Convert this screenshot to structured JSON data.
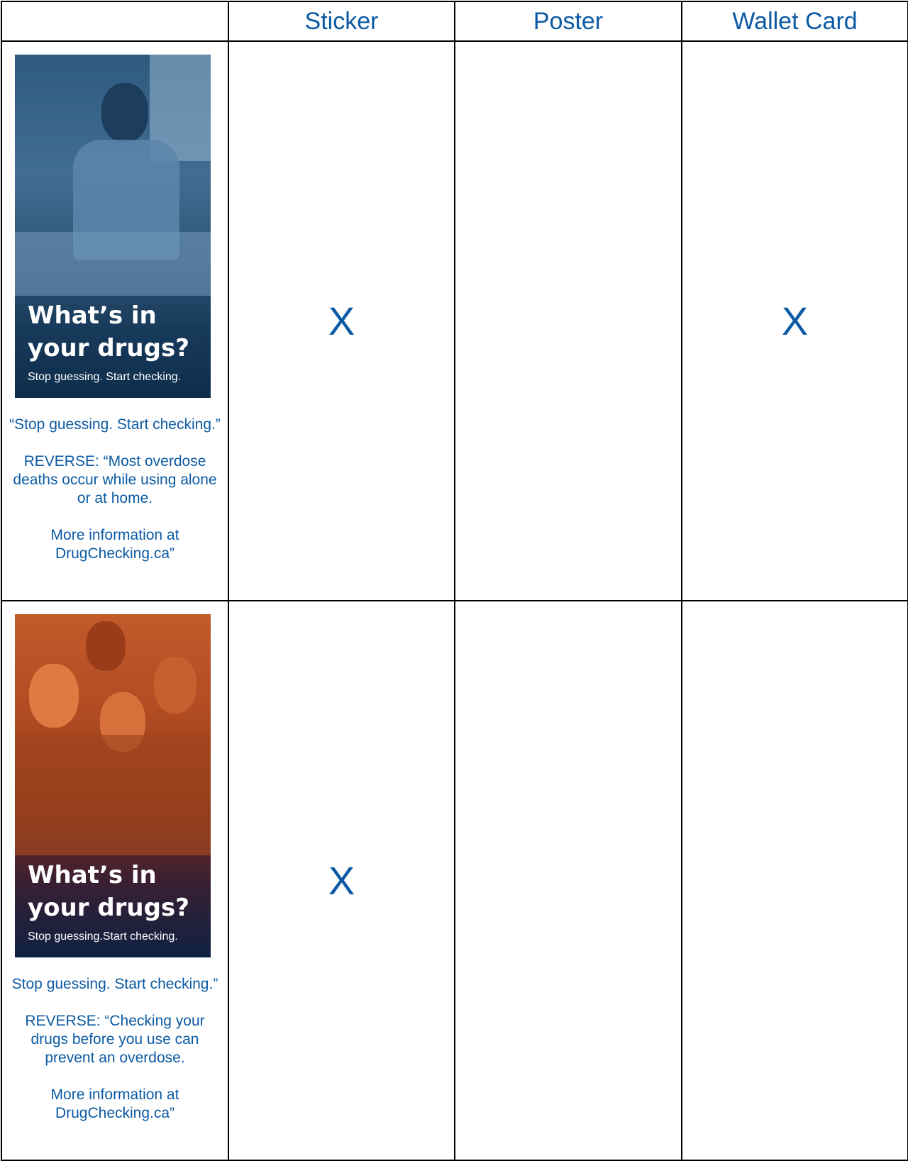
{
  "header": {
    "col1": "",
    "col2": "Sticker",
    "col3": "Poster",
    "col4": "Wallet Card"
  },
  "rows": [
    {
      "promo": {
        "headline_line1": "What’s in",
        "headline_line2": "your drugs?",
        "subline": "Stop guessing. Start checking."
      },
      "caption": {
        "p1": "“Stop guessing. Start checking.”",
        "p2": "REVERSE: “Most overdose deaths occur while using alone or at home.",
        "p3": "More information at DrugChecking.ca”"
      },
      "sticker": "X",
      "poster": "",
      "wallet_card": "X"
    },
    {
      "promo": {
        "headline_line1": "What’s in",
        "headline_line2": "your drugs?",
        "subline": "Stop guessing.Start checking."
      },
      "caption": {
        "p1": "Stop guessing. Start checking.”",
        "p2": "REVERSE: “Checking your drugs before you use can prevent an overdose.",
        "p3": "More information at DrugChecking.ca”"
      },
      "sticker": "X",
      "poster": "",
      "wallet_card": ""
    }
  ],
  "colors": {
    "text": "#0b5aa3",
    "promo1": "#2c5173",
    "promo2": "#b04b22"
  }
}
